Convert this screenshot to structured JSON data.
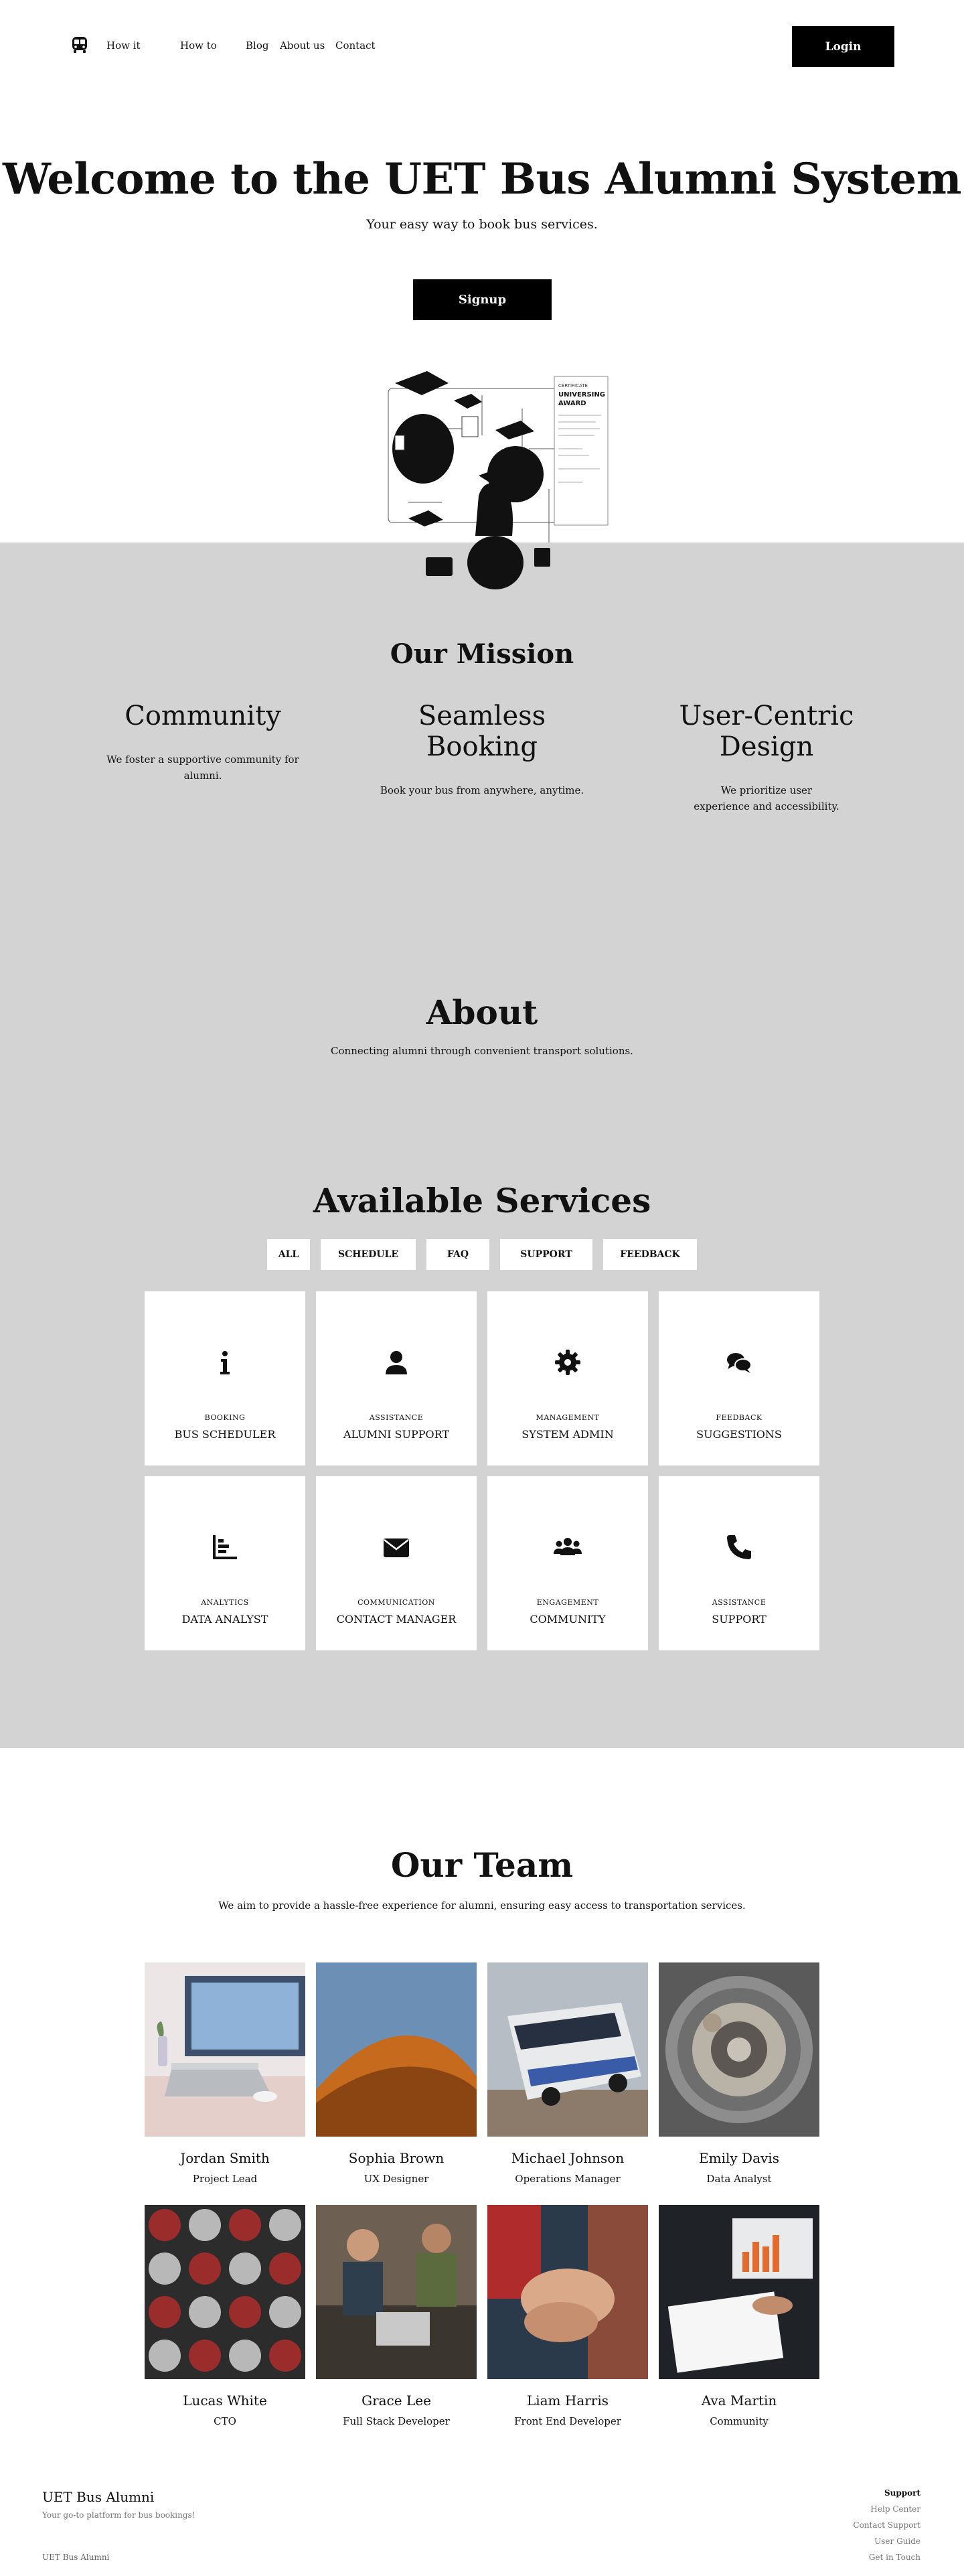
{
  "nav": {
    "links": [
      "How it",
      "How to",
      "Blog",
      "About us",
      "Contact"
    ],
    "login_label": "Login"
  },
  "hero": {
    "title": "Welcome to the UET Bus Alumni System",
    "subtitle": "Your easy way to book bus services.",
    "signup_label": "Signup",
    "illustration": {
      "award_title": [
        "UNIVERSING",
        "AWARD"
      ],
      "award_kicker": "CERTIFICATE"
    }
  },
  "mission": {
    "title": "Our Mission",
    "columns": [
      {
        "title": "Community",
        "text": "We foster a supportive community for alumni."
      },
      {
        "title": "Seamless Booking",
        "text": "Book your bus from anywhere, anytime."
      },
      {
        "title": "User-Centric Design",
        "text": "We prioritize user experience and accessibility."
      }
    ]
  },
  "about": {
    "title": "About",
    "subtitle": "Connecting alumni through convenient transport solutions."
  },
  "services": {
    "title": "Available Services",
    "filters": [
      "ALL",
      "SCHEDULE",
      "FAQ",
      "SUPPORT",
      "FEEDBACK"
    ],
    "cards": [
      {
        "category": "BOOKING",
        "name": "BUS SCHEDULER",
        "icon": "info-icon"
      },
      {
        "category": "ASSISTANCE",
        "name": "ALUMNI SUPPORT",
        "icon": "user-icon"
      },
      {
        "category": "MANAGEMENT",
        "name": "SYSTEM ADMIN",
        "icon": "gear-icon"
      },
      {
        "category": "FEEDBACK",
        "name": "SUGGESTIONS",
        "icon": "comments-icon"
      },
      {
        "category": "ANALYTICS",
        "name": "DATA ANALYST",
        "icon": "chart-icon"
      },
      {
        "category": "COMMUNICATION",
        "name": "CONTACT MANAGER",
        "icon": "envelope-icon"
      },
      {
        "category": "ENGAGEMENT",
        "name": "COMMUNITY",
        "icon": "users-icon"
      },
      {
        "category": "ASSISTANCE",
        "name": "SUPPORT",
        "icon": "phone-icon"
      }
    ]
  },
  "team": {
    "title": "Our Team",
    "subtitle": "We aim to provide a hassle-free experience for alumni, ensuring easy access to transportation services.",
    "members": [
      {
        "name": "Jordan Smith",
        "role": "Project Lead",
        "photo": "laptop-desk-photo"
      },
      {
        "name": "Sophia Brown",
        "role": "UX Designer",
        "photo": "desert-dune-photo"
      },
      {
        "name": "Michael Johnson",
        "role": "Operations Manager",
        "photo": "bus-photo"
      },
      {
        "name": "Emily Davis",
        "role": "Data Analyst",
        "photo": "watch-mechanism-photo"
      },
      {
        "name": "Lucas White",
        "role": "CTO",
        "photo": "helmets-photo"
      },
      {
        "name": "Grace Lee",
        "role": "Full Stack Developer",
        "photo": "coworkers-photo"
      },
      {
        "name": "Liam Harris",
        "role": "Front End Developer",
        "photo": "hands-together-photo"
      },
      {
        "name": "Ava Martin",
        "role": "Community",
        "photo": "laptop-chart-photo"
      }
    ]
  },
  "footer": {
    "brand": "UET Bus Alumni",
    "tagline": "Your go-to platform for bus bookings!",
    "copyright": "UET Bus Alumni",
    "support": {
      "heading": "Support",
      "links": [
        "Help Center",
        "Contact Support",
        "User Guide",
        "Get in Touch"
      ]
    }
  }
}
